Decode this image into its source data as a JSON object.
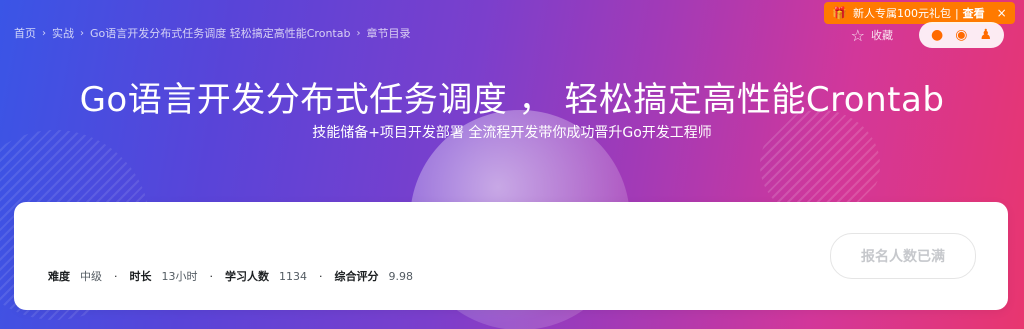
{
  "breadcrumb": {
    "items": [
      "首页",
      "实战",
      "Go语言开发分布式任务调度 轻松搞定高性能Crontab",
      "章节目录"
    ]
  },
  "promo": {
    "text": "新人专属100元礼包",
    "divider": "|",
    "link": "查看",
    "close": "×"
  },
  "header": {
    "favorite_label": "收藏",
    "share_icons": [
      "wechat-icon",
      "weibo-icon",
      "qq-icon"
    ]
  },
  "course": {
    "title": "Go语言开发分布式任务调度 ， 轻松搞定高性能Crontab",
    "subtitle": "技能储备+项目开发部署 全流程开发带你成功晋升Go开发工程师"
  },
  "stats": {
    "difficulty_label": "难度",
    "difficulty_value": "中级",
    "duration_label": "时长",
    "duration_value": "13小时",
    "learners_label": "学习人数",
    "learners_value": "1134",
    "rating_label": "综合评分",
    "rating_value": "9.98",
    "separator": "·"
  },
  "enroll_button": "报名人数已满",
  "colors": {
    "promo_bg": "#ff7a00",
    "gradient_start": "#3a55e6",
    "gradient_end": "#e8366f"
  }
}
